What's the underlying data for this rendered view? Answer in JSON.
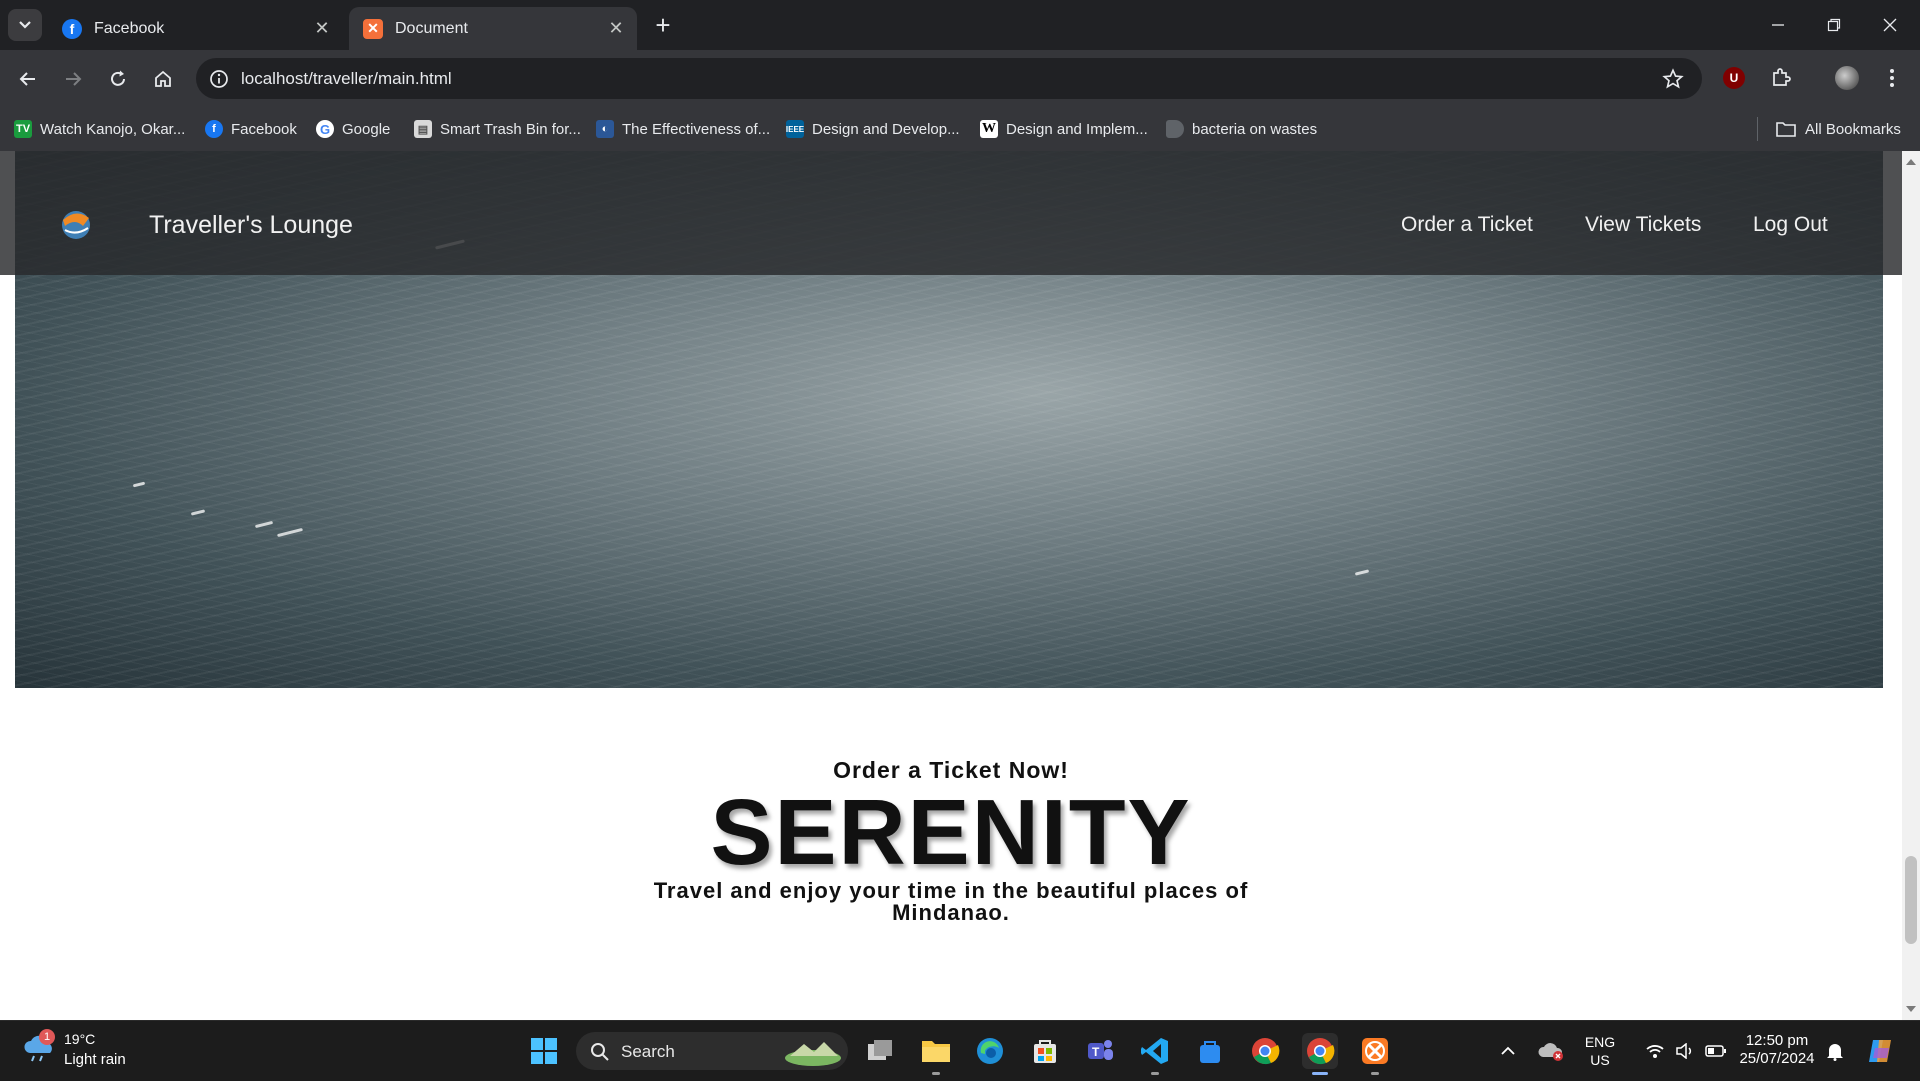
{
  "browser": {
    "tabs": [
      {
        "title": "Facebook",
        "active": false
      },
      {
        "title": "Document",
        "active": true
      }
    ],
    "address": "localhost/traveller/main.html",
    "bookmarks": [
      {
        "label": "Watch Kanojo, Okar...",
        "icon": "tv-icon"
      },
      {
        "label": "Facebook",
        "icon": "facebook-icon"
      },
      {
        "label": "Google",
        "icon": "google-icon"
      },
      {
        "label": "Smart Trash Bin for...",
        "icon": "document-icon"
      },
      {
        "label": "The Effectiveness of...",
        "icon": "globe-icon"
      },
      {
        "label": "Design and Develop...",
        "icon": "ieee-icon"
      },
      {
        "label": "Design and Implem...",
        "icon": "wikipedia-icon"
      },
      {
        "label": "bacteria on wastes",
        "icon": "generic-icon"
      }
    ],
    "all_bookmarks": "All Bookmarks"
  },
  "site": {
    "brand": "Traveller's Lounge",
    "nav": [
      "Order a Ticket",
      "View Tickets",
      "Log Out"
    ],
    "cta_small": "Order a Ticket Now!",
    "cta_big": "SERENITY",
    "cta_sub": "Travel and enjoy your time in the beautiful places of Mindanao."
  },
  "taskbar": {
    "weather_temp": "19°C",
    "weather_desc": "Light rain",
    "weather_badge": "1",
    "search_label": "Search",
    "lang_top": "ENG",
    "lang_bottom": "US",
    "time": "12:50 pm",
    "date": "25/07/2024"
  },
  "colors": {
    "chrome_dark": "#202124",
    "chrome_toolbar": "#35363a",
    "navbar_overlay": "#2a2c2e",
    "taskbar": "#1c1c1c"
  }
}
